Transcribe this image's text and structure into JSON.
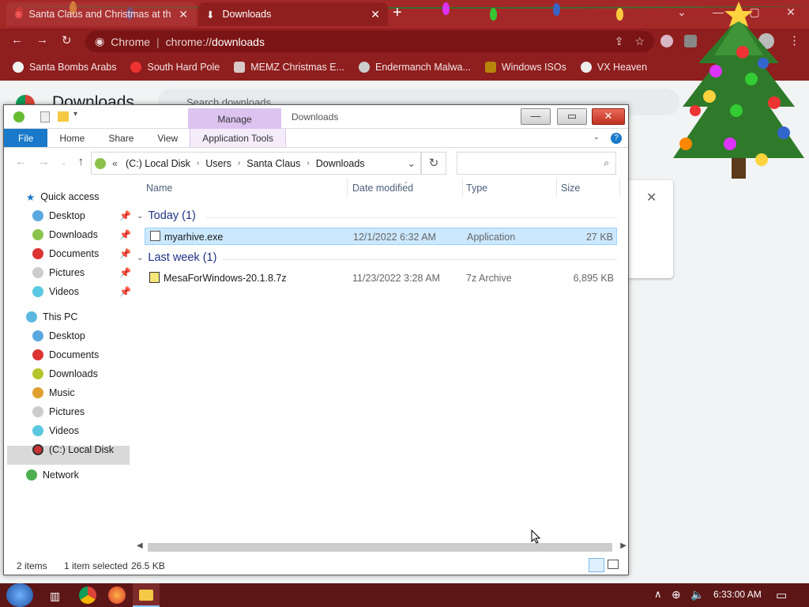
{
  "browser": {
    "tabs": [
      {
        "label": "Santa Claus and Christmas at th",
        "close": "✕"
      },
      {
        "label": "Downloads",
        "close": "✕"
      }
    ],
    "new_tab": "+",
    "omnibox": {
      "site": "Chrome",
      "url_prefix": "chrome://",
      "url_path": "downloads"
    },
    "bookmarks": [
      "Santa Bombs Arabs",
      "South Hard Pole",
      "MEMZ Christmas E...",
      "Endermanch Malwa...",
      "Windows ISOs",
      "VX Heaven"
    ],
    "downloads_page": {
      "title": "Downloads",
      "search_placeholder": "Search downloads",
      "card_close": "✕"
    }
  },
  "explorer": {
    "ribbon_context_tab": "Manage",
    "window_title": "Downloads",
    "ribbon_tabs": [
      "File",
      "Home",
      "Share",
      "View",
      "Application Tools"
    ],
    "breadcrumb": [
      "(C:) Local Disk",
      "Users",
      "Santa Claus",
      "Downloads"
    ],
    "breadcrumb_prefix": "«",
    "nav": {
      "quick_access": "Quick access",
      "quick_items": [
        "Desktop",
        "Downloads",
        "Documents",
        "Pictures",
        "Videos"
      ],
      "this_pc": "This PC",
      "pc_items": [
        "Desktop",
        "Documents",
        "Downloads",
        "Music",
        "Pictures",
        "Videos",
        "(C:) Local Disk"
      ],
      "network": "Network"
    },
    "columns": {
      "name": "Name",
      "date": "Date modified",
      "type": "Type",
      "size": "Size"
    },
    "groups": [
      {
        "label": "Today (1)",
        "files": [
          {
            "name": "myarhive.exe",
            "date": "12/1/2022 6:32 AM",
            "type": "Application",
            "size": "27 KB",
            "selected": true
          }
        ]
      },
      {
        "label": "Last week (1)",
        "files": [
          {
            "name": "MesaForWindows-20.1.8.7z",
            "date": "11/23/2022 3:28 AM",
            "type": "7z Archive",
            "size": "6,895 KB",
            "selected": false
          }
        ]
      }
    ],
    "status": {
      "items": "2 items",
      "selected": "1 item selected",
      "size": "26.5 KB"
    }
  },
  "taskbar": {
    "clock": "6:33:00 AM"
  },
  "colors": {
    "chrome_red": "#8f1e1e",
    "file_tab": "#1979ca",
    "selection": "#cce8ff",
    "manage_tab": "#ddc3f0"
  }
}
